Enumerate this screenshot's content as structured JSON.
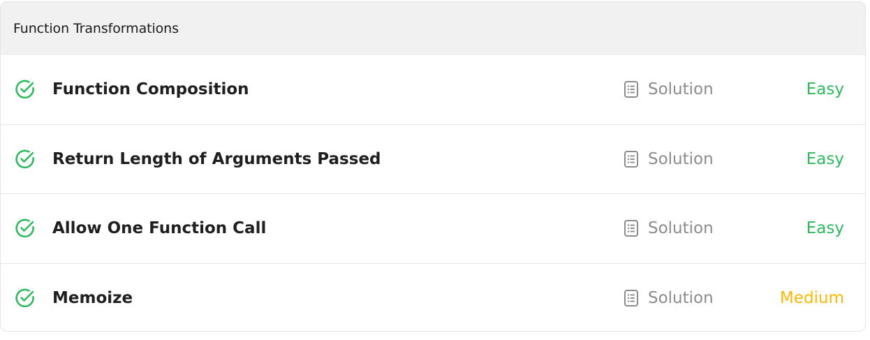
{
  "section": {
    "title": "Function Transformations"
  },
  "colors": {
    "easy": "#2cbb5d",
    "medium": "#ffb800",
    "check": "#2cbb5d"
  },
  "problems": [
    {
      "title": "Function Composition",
      "solution_label": "Solution",
      "difficulty": "Easy",
      "difficulty_level": "easy",
      "status_icon": "check-circle-icon"
    },
    {
      "title": "Return Length of Arguments Passed",
      "solution_label": "Solution",
      "difficulty": "Easy",
      "difficulty_level": "easy",
      "status_icon": "check-circle-icon"
    },
    {
      "title": "Allow One Function Call",
      "solution_label": "Solution",
      "difficulty": "Easy",
      "difficulty_level": "easy",
      "status_icon": "check-circle-icon"
    },
    {
      "title": "Memoize",
      "solution_label": "Solution",
      "difficulty": "Medium",
      "difficulty_level": "medium",
      "status_icon": "check-circle-icon"
    }
  ]
}
